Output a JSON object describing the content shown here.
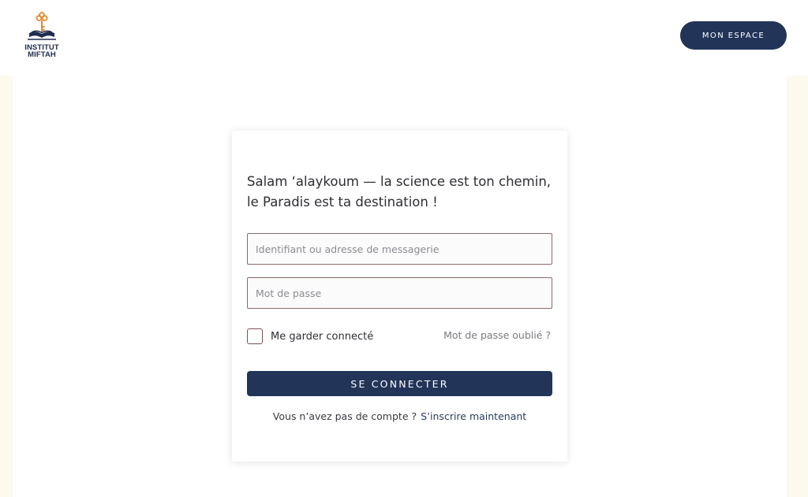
{
  "header": {
    "logo_text_line1": "INSTITUT",
    "logo_text_line2": "MIFTAH",
    "space_button_label": "MON ESPACE"
  },
  "login": {
    "greeting_line1": "Salam ‘alaykoum — la science est ton chemin,",
    "greeting_line2": "le Paradis est ta destination !",
    "username_placeholder": "Identifiant ou adresse de messagerie",
    "username_value": "",
    "password_placeholder": "Mot de passe",
    "password_value": "",
    "remember_label": "Me garder connecté",
    "remember_checked": false,
    "forgot_link": "Mot de passe oublié ?",
    "submit_label": "SE CONNECTER",
    "signup_prompt": "Vous n’avez pas de compte ?",
    "signup_link": "S’inscrire maintenant"
  },
  "icons": {
    "logo": "key-book-logo-icon"
  },
  "colors": {
    "navy": "#223458",
    "page_background": "#fcf9ed",
    "logo_key": "#e2892b",
    "field_border": "#8c6a6a"
  }
}
